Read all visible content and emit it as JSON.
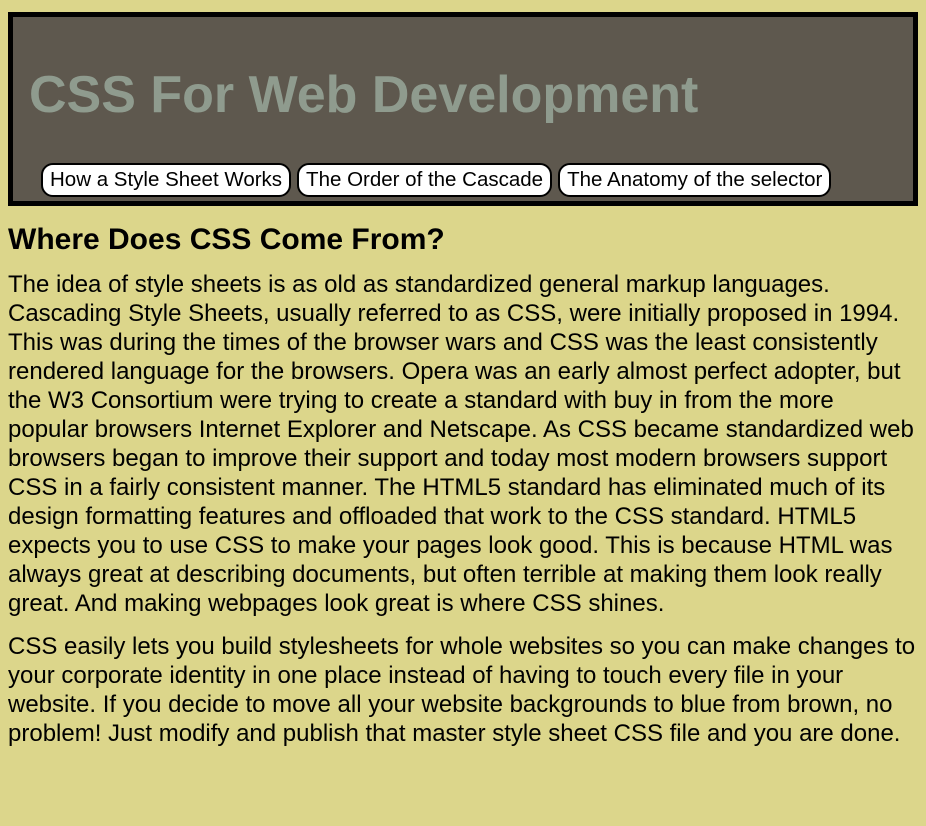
{
  "header": {
    "title": "CSS For Web Development"
  },
  "nav": {
    "items": [
      {
        "label": "How a Style Sheet Works"
      },
      {
        "label": "The Order of the Cascade"
      },
      {
        "label": "The Anatomy of the selector"
      }
    ]
  },
  "article": {
    "heading": "Where Does CSS Come From?",
    "paragraphs": [
      "The idea of style sheets is as old as standardized general markup languages. Cascading Style Sheets, usually referred to as CSS, were initially proposed in 1994. This was during the times of the browser wars and CSS was the least consistently rendered language for the browsers. Opera was an early almost perfect adopter, but the W3 Consortium were trying to create a standard with buy in from the more popular browsers Internet Explorer and Netscape. As CSS became standardized web browsers began to improve their support and today most modern browsers support CSS in a fairly consistent manner. The HTML5 standard has eliminated much of its design formatting features and offloaded that work to the CSS standard. HTML5 expects you to use CSS to make your pages look good. This is because HTML was always great at describing documents, but often terrible at making them look really great. And making webpages look great is where CSS shines.",
      "CSS easily lets you build stylesheets for whole websites so you can make changes to your corporate identity in one place instead of having to touch every file in your website. If you decide to move all your website backgrounds to blue from brown, no problem! Just modify and publish that master style sheet CSS file and you are done."
    ]
  }
}
